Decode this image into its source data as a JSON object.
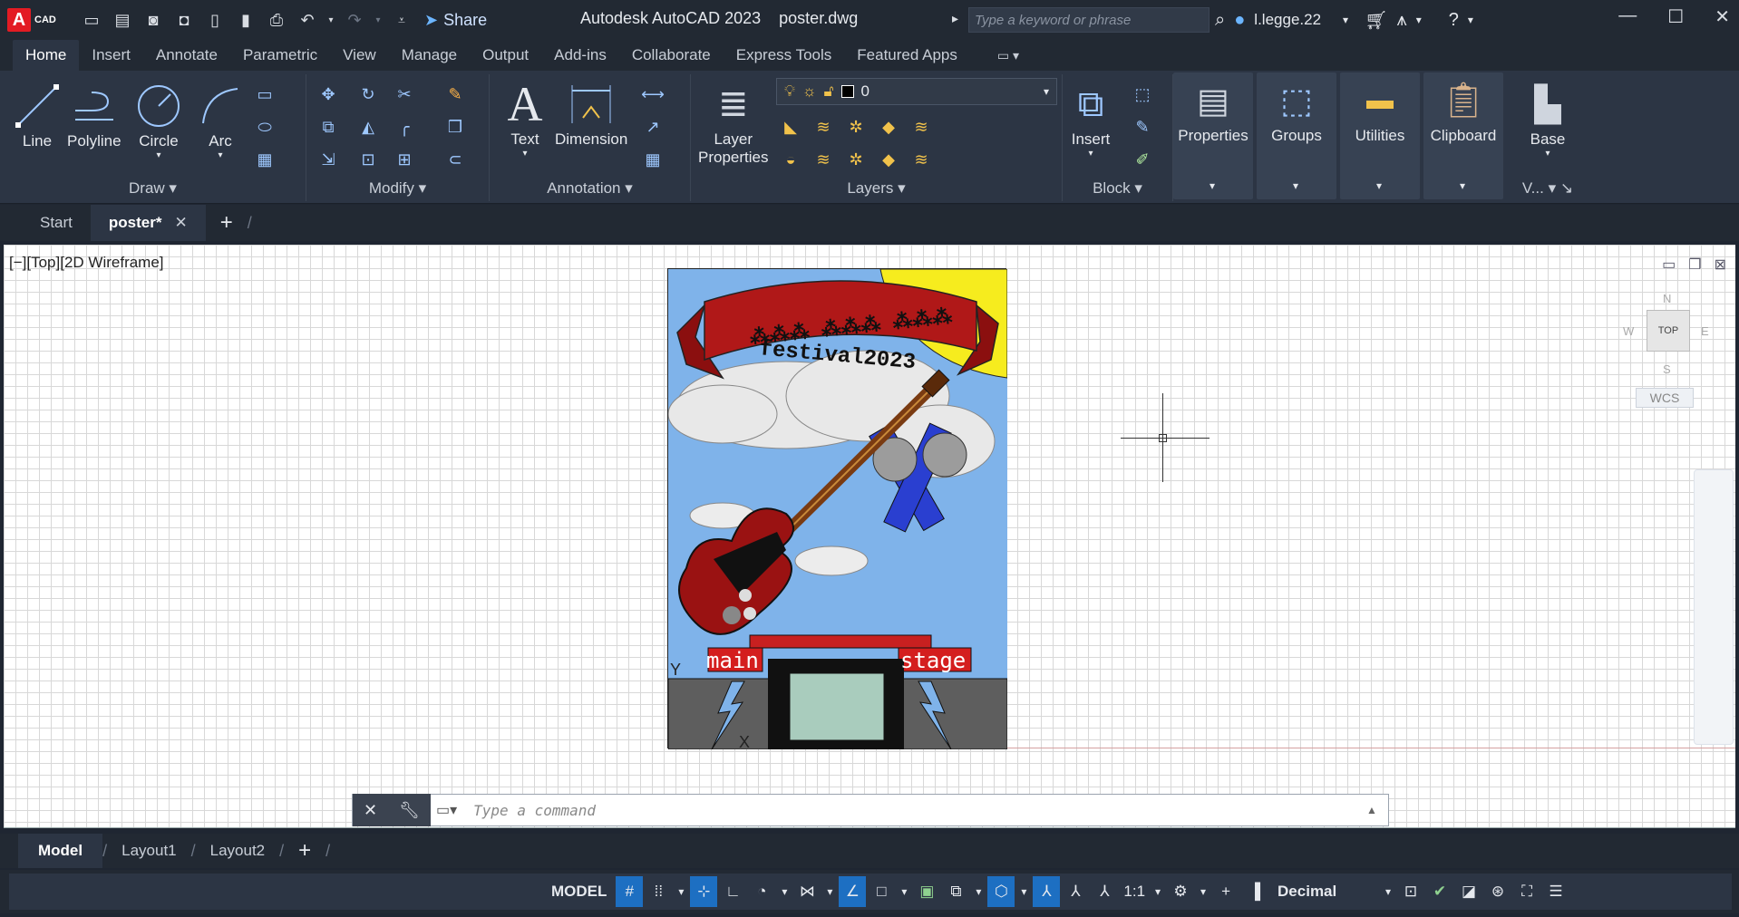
{
  "app": {
    "logo_letter": "A",
    "logo_text": "CAD",
    "title": "Autodesk AutoCAD 2023",
    "document": "poster.dwg",
    "share": "Share",
    "search_placeholder": "Type a keyword or phrase",
    "user": "l.legge.22"
  },
  "ribbon_tabs": [
    "Home",
    "Insert",
    "Annotate",
    "Parametric",
    "View",
    "Manage",
    "Output",
    "Add-ins",
    "Collaborate",
    "Express Tools",
    "Featured Apps"
  ],
  "ribbon": {
    "draw": {
      "title": "Draw",
      "line": "Line",
      "polyline": "Polyline",
      "circle": "Circle",
      "arc": "Arc"
    },
    "modify": {
      "title": "Modify"
    },
    "annotation": {
      "title": "Annotation",
      "text": "Text",
      "dimension": "Dimension"
    },
    "layers": {
      "title": "Layers",
      "layer_properties_1": "Layer",
      "layer_properties_2": "Properties",
      "current_layer": "0"
    },
    "block": {
      "title": "Block",
      "insert": "Insert"
    },
    "properties": "Properties",
    "groups": "Groups",
    "utilities": "Utilities",
    "clipboard": "Clipboard",
    "view": {
      "base": "Base",
      "title": "V..."
    }
  },
  "file_tabs": {
    "start": "Start",
    "active": "poster*"
  },
  "viewport": {
    "label": "[−][Top][2D Wireframe]",
    "viewcube_top": "TOP",
    "dir_n": "N",
    "dir_s": "S",
    "dir_e": "E",
    "dir_w": "W",
    "wcs": "WCS"
  },
  "poster": {
    "banner_text": "festival2023",
    "left_sign": "main",
    "right_sign": "stage",
    "ucs_y": "Y",
    "ucs_x": "X"
  },
  "command": {
    "placeholder": "Type a command"
  },
  "layout_tabs": {
    "model": "Model",
    "layout1": "Layout1",
    "layout2": "Layout2"
  },
  "status": {
    "mode": "MODEL",
    "scale": "1:1",
    "units": "Decimal"
  }
}
